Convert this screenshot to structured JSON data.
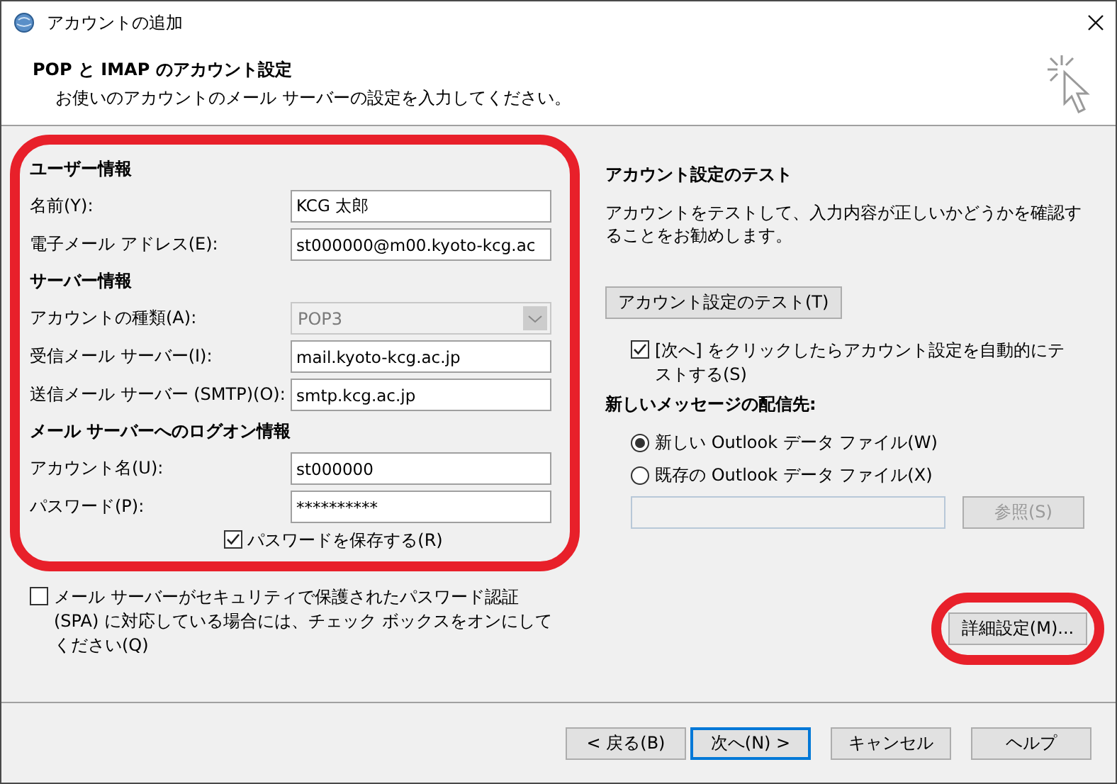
{
  "window": {
    "title": "アカウントの追加"
  },
  "header": {
    "title": "POP と IMAP のアカウント設定",
    "subtitle": "お使いのアカウントのメール サーバーの設定を入力してください。"
  },
  "account_form": {
    "highlighted": true,
    "sections": [
      {
        "heading": "ユーザー情報",
        "fields": [
          {
            "label": "名前(Y):",
            "value": "KCG 太郎",
            "kind": "text"
          },
          {
            "label": "電子メール アドレス(E):",
            "value": "st000000@m00.kyoto-kcg.ac",
            "kind": "text"
          }
        ]
      },
      {
        "heading": "サーバー情報",
        "fields": [
          {
            "label": "アカウントの種類(A):",
            "value": "POP3",
            "kind": "select"
          },
          {
            "label": "受信メール サーバー(I):",
            "value": "mail.kyoto-kcg.ac.jp",
            "kind": "text"
          },
          {
            "label": "送信メール サーバー (SMTP)(O):",
            "value": "smtp.kcg.ac.jp",
            "kind": "text"
          }
        ]
      },
      {
        "heading": "メール サーバーへのログオン情報",
        "fields": [
          {
            "label": "アカウント名(U):",
            "value": "st000000",
            "kind": "text"
          },
          {
            "label": "パスワード(P):",
            "value": "**********",
            "kind": "text"
          }
        ]
      }
    ],
    "save_password": {
      "label": "パスワードを保存する(R)",
      "checked": true
    }
  },
  "spa": {
    "label": "メール サーバーがセキュリティで保護されたパスワード認証 (SPA) に対応している場合には、チェック ボックスをオンにしてください(Q)",
    "checked": false
  },
  "test": {
    "heading": "アカウント設定のテスト",
    "description": "アカウントをテストして、入力内容が正しいかどうかを確認することをお勧めします。",
    "button": "アカウント設定のテスト(T)",
    "auto_test": {
      "label": "[次へ] をクリックしたらアカウント設定を自動的にテストする(S)",
      "checked": true
    }
  },
  "delivery": {
    "heading": "新しいメッセージの配信先:",
    "options": [
      {
        "label": "新しい Outlook データ ファイル(W)",
        "selected": true
      },
      {
        "label": "既存の Outlook データ ファイル(X)",
        "selected": false
      }
    ],
    "browse": {
      "label": "参照(S)",
      "disabled": true
    }
  },
  "advanced": {
    "label": "詳細設定(M)...",
    "highlighted": true
  },
  "footer": [
    {
      "label": "< 戻る(B)",
      "default": false
    },
    {
      "label": "次へ(N) >",
      "default": true
    },
    {
      "label": "キャンセル",
      "default": false
    },
    {
      "label": "ヘルプ",
      "default": false
    }
  ]
}
